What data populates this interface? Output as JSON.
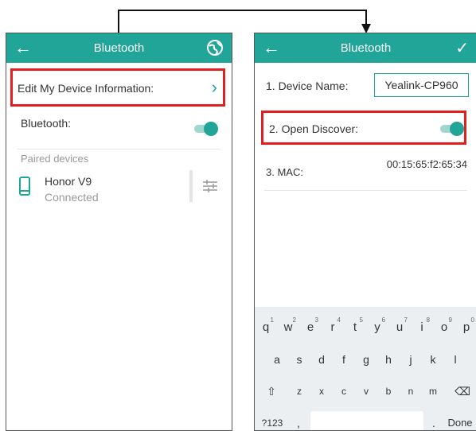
{
  "left": {
    "title": "Bluetooth",
    "edit_device_label": "Edit My Device Information:",
    "bluetooth_label": "Bluetooth:",
    "paired_header": "Paired devices",
    "device_name": "Honor V9",
    "device_status": "Connected",
    "bluetooth_on": true
  },
  "right": {
    "title": "Bluetooth",
    "device_name_label": "1. Device Name:",
    "device_name_value": "Yealink-CP960",
    "open_discover_label": "2. Open Discover:",
    "mac_label": "3. MAC:",
    "mac_value": "00:15:65:f2:65:34",
    "open_discover_on": true
  },
  "keyboard": {
    "row1": [
      {
        "k": "q",
        "n": "1"
      },
      {
        "k": "w",
        "n": "2"
      },
      {
        "k": "e",
        "n": "3"
      },
      {
        "k": "r",
        "n": "4"
      },
      {
        "k": "t",
        "n": "5"
      },
      {
        "k": "y",
        "n": "6"
      },
      {
        "k": "u",
        "n": "7"
      },
      {
        "k": "i",
        "n": "8"
      },
      {
        "k": "o",
        "n": "9"
      },
      {
        "k": "p",
        "n": "0"
      }
    ],
    "row2": [
      "a",
      "s",
      "d",
      "f",
      "g",
      "h",
      "j",
      "k",
      "l"
    ],
    "row3": [
      "z",
      "x",
      "c",
      "v",
      "b",
      "n",
      "m"
    ],
    "shift": "⇧",
    "backspace": "⌫",
    "symbols": "?123",
    "comma": ",",
    "period": ".",
    "done": "Done"
  },
  "colors": {
    "accent": "#20a598",
    "highlight": "#e02020"
  }
}
